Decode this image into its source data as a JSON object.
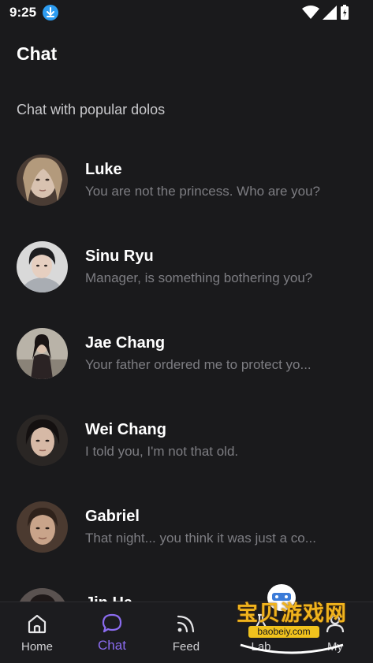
{
  "status_bar": {
    "time": "9:25"
  },
  "header": {
    "title": "Chat"
  },
  "section": {
    "label": "Chat with popular dolos"
  },
  "chats": [
    {
      "name": "Luke",
      "preview": "You are not the princess. Who are you?",
      "avatar_color": "#8c7a6e"
    },
    {
      "name": "Sinu Ryu",
      "preview": "Manager, is something bothering you?",
      "avatar_color": "#b8b8b8"
    },
    {
      "name": "Jae Chang",
      "preview": "Your father ordered me to protect yo...",
      "avatar_color": "#6e6a63"
    },
    {
      "name": "Wei Chang",
      "preview": "I told you, I'm not that old.",
      "avatar_color": "#3a3330"
    },
    {
      "name": "Gabriel",
      "preview": "That night... you think it was just a co...",
      "avatar_color": "#6b5344"
    },
    {
      "name": "Jin Ha",
      "preview": "",
      "avatar_color": "#555"
    }
  ],
  "bottom_nav": {
    "items": [
      {
        "label": "Home",
        "icon": "home-icon"
      },
      {
        "label": "Chat",
        "icon": "chat-bubble-icon",
        "active": true
      },
      {
        "label": "Feed",
        "icon": "rss-feed-icon"
      },
      {
        "label": "Lab",
        "icon": "lab-icon"
      },
      {
        "label": "My",
        "icon": "profile-icon"
      }
    ]
  },
  "watermark": {
    "text": "宝贝游戏网",
    "url": "baobeiy.com"
  },
  "colors": {
    "accent": "#8b6cf0",
    "background": "#1a1a1c",
    "preview_text": "#7d7d82"
  }
}
